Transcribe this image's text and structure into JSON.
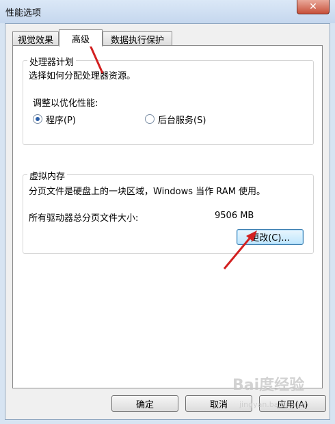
{
  "window": {
    "title": "性能选项",
    "close_symbol": "✕"
  },
  "tabs": [
    {
      "label": "视觉效果"
    },
    {
      "label": "高级"
    },
    {
      "label": "数据执行保护"
    }
  ],
  "processor": {
    "legend": "处理器计划",
    "description": "选择如何分配处理器资源。",
    "adjust_label": "调整以优化性能:",
    "radio_programs": "程序(P)",
    "radio_background": "后台服务(S)",
    "selected": "programs"
  },
  "virtual_memory": {
    "legend": "虚拟内存",
    "description": "分页文件是硬盘上的一块区域，Windows 当作 RAM 使用。",
    "total_label": "所有驱动器总分页文件大小:",
    "total_value": "9506 MB",
    "change_button": "更改(C)..."
  },
  "footer": {
    "ok": "确定",
    "cancel": "取消",
    "apply": "应用(A)"
  },
  "watermark": {
    "text": "Bai度经验",
    "url": "jingyan.baidu.com"
  },
  "colors": {
    "arrow": "#d22020"
  }
}
